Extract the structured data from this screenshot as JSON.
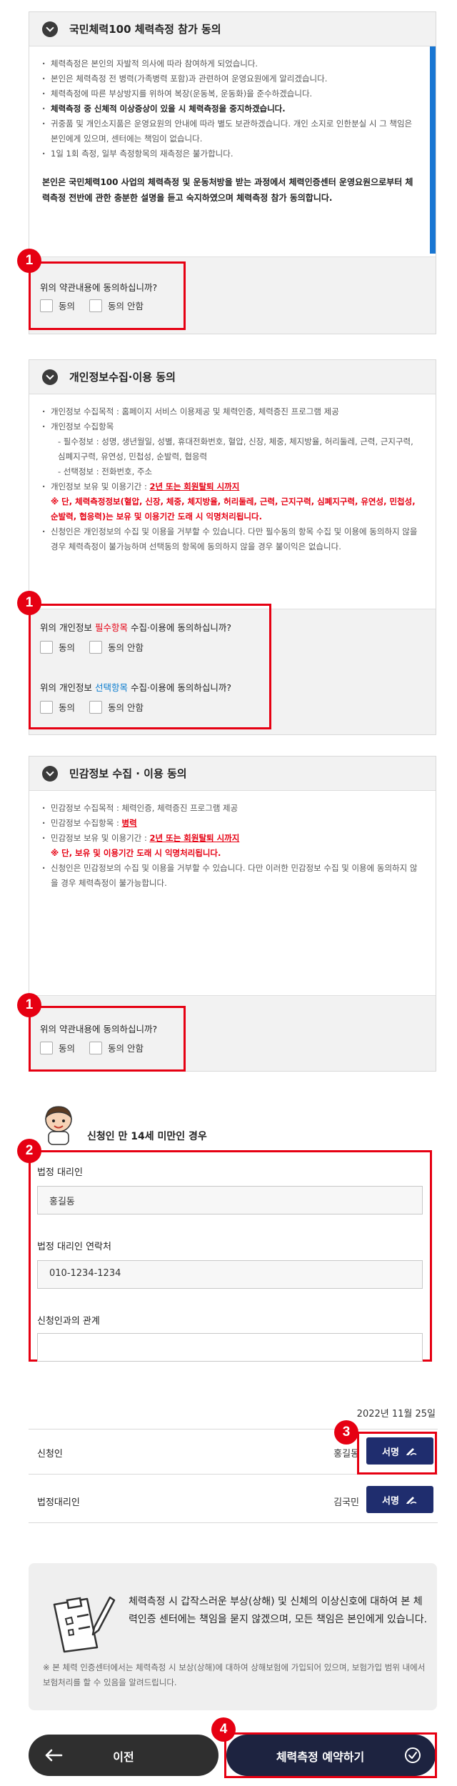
{
  "sections": {
    "fitness": {
      "title": "국민체력100 체력측정 참가 동의",
      "items": [
        "체력측정은 본인의 자발적 의사에 따라 참여하게 되었습니다.",
        "본인은 체력측정 전 병력(가족병력 포함)과 관련하여 운영요원에게 알리겠습니다.",
        "체력측정에 따른 부상방지를 위하여 복장(운동복, 운동화)을 준수하겠습니다.",
        "체력측정 중 신체적 이상증상이 있을 시 체력측정을 중지하겠습니다.",
        "귀중품 및 개인소지품은 운영요원의 안내에 따라 별도 보관하겠습니다. 개인 소지로 인한분실 시 그 책임은 본인에게 있으며, 센터에는 책임이 없습니다.",
        "1일 1회 측정, 일부 측정항목의 재측정은 불가합니다."
      ],
      "note": "본인은 국민체력100 사업의 체력측정 및 운동처방을 받는 과정에서 체력인증센터 운영요원으로부터 체력측정 전반에 관한 충분한 설명을 듣고 숙지하였으며 체력측정 참가 동의합니다.",
      "question": "위의 약관내용에 동의하십니까?"
    },
    "privacy": {
      "title": "개인정보수집·이용 동의",
      "item1": "개인정보 수집목적 : 홈페이지 서비스 이용제공 및 체력인증, 체력증진 프로그램 제공",
      "item2_head": "개인정보 수집항목",
      "item2_required": "- 필수정보 : 성명, 생년월일, 성별, 휴대전화번호, 혈압, 신장, 체중, 체지방율, 허리둘레, 근력, 근지구력, 심폐지구력, 유연성, 민첩성, 순발력, 협응력",
      "item2_optional": "- 선택정보 : 전화번호, 주소",
      "item3_prefix": "개인정보 보유 및 이용기간 : ",
      "item3_period": "2년 또는 회원탈퇴 시까지",
      "item3_warning": "※ 단, 체력측정정보(혈압, 신장, 체중, 체지방율, 허리둘레, 근력, 근지구력, 심폐지구력, 유연성, 민첩성, 순발력, 협응력)는 보유 및 이용기간 도래 시 익명처리됩니다.",
      "item4": "신청인은 개인정보의 수집 및 이용을 거부할 수 있습니다. 다만 필수동의 항목 수집 및 이용에 동의하지 않을 경우 체력측정이 불가능하며 선택동의 항목에 동의하지 않을 경우 불이익은 없습니다.",
      "q_required_prefix": "위의 개인정보 ",
      "q_required_highlight": "필수항목",
      "q_required_suffix": " 수집·이용에 동의하십니까?",
      "q_optional_prefix": "위의 개인정보 ",
      "q_optional_highlight": "선택항목",
      "q_optional_suffix": " 수집·이용에 동의하십니까?"
    },
    "sensitive": {
      "title": "민감정보 수집 · 이용 동의",
      "item1": "민감정보 수집목적 : 체력인증, 체력증진 프로그램 제공",
      "item2_prefix": "민감정보 수집항목 : ",
      "item2_value": "병력",
      "item3_prefix": "민감정보 보유 및 이용기간 : ",
      "item3_period": "2년 또는 회원탈퇴 시까지",
      "item3_warning": "※ 단, 보유 및 이용기간 도래 시 익명처리됩니다.",
      "item4": "신청인은 민감정보의 수집 및 이용을 거부할 수 있습니다. 다만 이러한 민감정보 수집 및 이용에 동의하지 않을 경우 체력측정이 불가능합니다.",
      "question": "위의 약관내용에 동의하십니까?"
    }
  },
  "options": {
    "agree": "동의",
    "disagree": "동의 안함"
  },
  "badges": {
    "b1": "1",
    "b2": "2",
    "b3": "3",
    "b4": "4"
  },
  "minor": {
    "heading": "신청인 만 14세 미만인 경우",
    "rep_label": "법정 대리인",
    "rep_value": "홍길동",
    "contact_label": "법정 대리인 연락처",
    "contact_value": "010-1234-1234",
    "relation_label": "신청인과의 관계",
    "relation_value": ""
  },
  "signature": {
    "date": "2022년 11월 25일",
    "applicant_label": "신청인",
    "applicant_name": "홍길동",
    "rep_label": "법정대리인",
    "rep_name": "김국민",
    "sign_button": "서명"
  },
  "notice": {
    "main": "체력측정 시 갑작스러운 부상(상해) 및 신체의 이상신호에 대하여 본 체력인증 센터에는 책임을 묻지 않겠으며, 모든 책임은 본인에게 있습니다.",
    "sub": "※ 본 체력 인증센터에서는 체력측정 시 보상(상해)에 대하여 상해보험에 가입되어 있으며, 보험가입 범위 내에서 보험처리를 할 수 있음을 알려드립니다."
  },
  "buttons": {
    "prev": "이전",
    "submit": "체력측정 예약하기"
  },
  "colors": {
    "accent_red": "#e60012",
    "navy": "#1f2d6e",
    "dark": "#1d2340",
    "link_blue": "#0a7ccf"
  }
}
